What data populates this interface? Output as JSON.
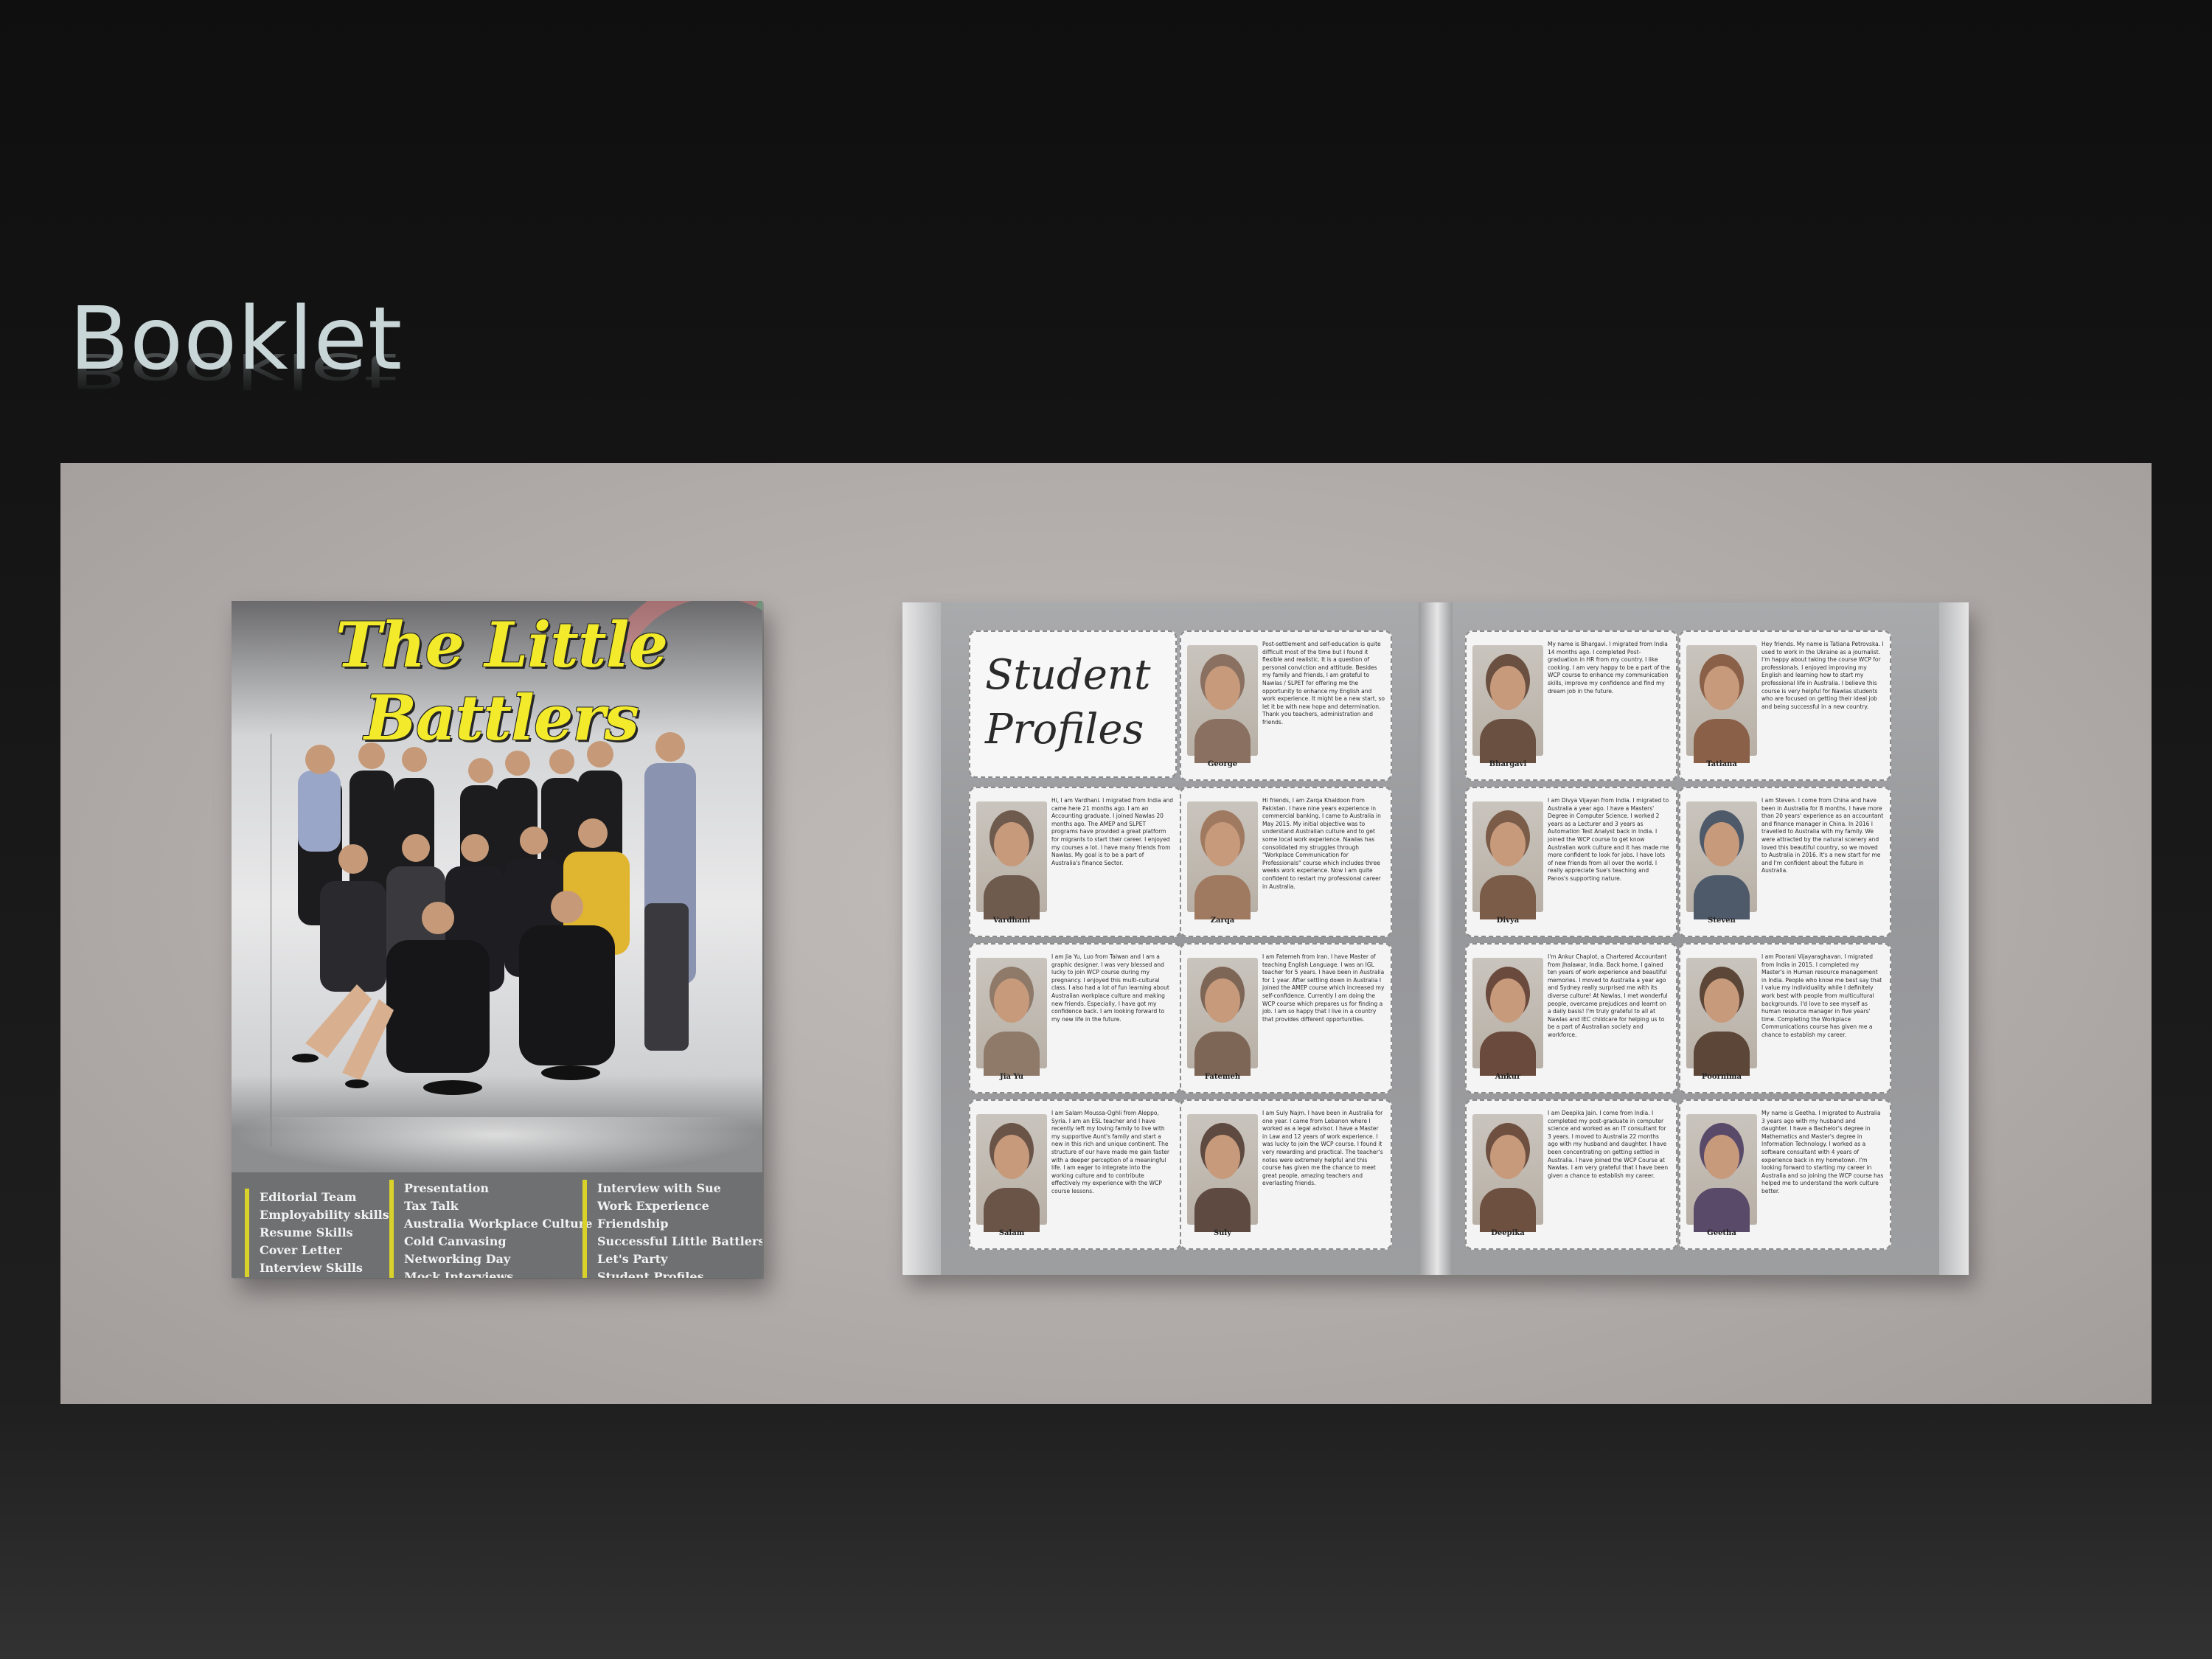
{
  "slide": {
    "title": "Booklet"
  },
  "cover": {
    "title": "The Little Battlers",
    "toc_columns": [
      [
        "Editorial Team",
        "Employability skills",
        "Resume Skills",
        "Cover Letter",
        "Interview Skills"
      ],
      [
        "Presentation",
        "Tax Talk",
        "Australia Workplace Culture",
        "Cold Canvasing",
        "Networking Day",
        "Mock Interviews"
      ],
      [
        "Interview with Sue",
        "Work Experience",
        "Friendship",
        "Successful Little Battlers",
        "Let's Party",
        "Student Profiles"
      ]
    ]
  },
  "spread": {
    "heading": "Student Profiles",
    "left_profiles": [
      {
        "name": "George",
        "text": "Post-settlement and self-education is quite difficult most of the time but I found it flexible and realistic. It is a question of personal conviction and attitude. Besides my family and friends, I am grateful to Nawlas / SLPET for offering me the opportunity to enhance my English and work experience. It might be a new start, so let it be with new hope and determination. Thank you teachers, administration and friends.",
        "photo_color": "#8a7060"
      },
      {
        "name": "Vardhani",
        "text": "Hi, I am Vardhani. I migrated from India and came here 21 months ago. I am an Accounting graduate. I joined Nawlas 20 months ago. The AMEP and SLPET programs have provided a great platform for migrants to start their career. I enjoyed my courses a lot. I have many friends from Nawlas. My goal is to be a part of Australia's finance Sector.",
        "photo_color": "#6f5a4e"
      },
      {
        "name": "Zarqa",
        "text": "Hi friends, I am Zarqa Khaldoon from Pakistan. I have nine years experience in commercial banking. I came to Australia in May 2015. My initial objective was to understand Australian culture and to get some local work experience. Nawlas has consolidated my struggles through \"Workplace Communication for Professionals\" course which includes three weeks work experience. Now I am quite confident to restart my professional career in Australia.",
        "photo_color": "#a07a60"
      },
      {
        "name": "Jia Yu",
        "text": "I am Jia Yu, Luo from Taiwan and I am a graphic designer. I was very blessed and lucky to join WCP course during my pregnancy. I enjoyed this multi-cultural class. I also had a lot of fun learning about Australian workplace culture and making new friends. Especially, I have got my confidence back. I am looking forward to my new life in the future.",
        "photo_color": "#8f7a6a"
      },
      {
        "name": "Fatemeh",
        "text": "I am Fatemeh from Iran. I have Master of teaching English Language. I was an IGL teacher for 5 years. I have been in Australia for 1 year. After settling down in Australia I joined the AMEP course which increased my self-confidence. Currently I am doing the WCP course which prepares us for finding a job. I am so happy that I live in a country that provides different opportunities.",
        "photo_color": "#7e6656"
      },
      {
        "name": "Salam",
        "text": "I am Salam Moussa-Oghli from Aleppo, Syria. I am an ESL teacher and I have recently left my loving family to live with my supportive Aunt's family and start a new in this rich and unique continent. The structure of our have made me gain faster with a deeper perception of a meaningful life. I am eager to integrate into the working culture and to contribute effectively my experience with the WCP course lessons.",
        "photo_color": "#6a5448"
      },
      {
        "name": "Suly",
        "text": "I am Suly Najm. I have been in Australia for one year. I came from Lebanon where I worked as a legal advisor. I have a Master in Law and 12 years of work experience. I was lucky to join the WCP course. I found it very rewarding and practical. The teacher's notes were extremely helpful and this course has given me the chance to meet great people, amazing teachers and everlasting friends.",
        "photo_color": "#5e4a40"
      }
    ],
    "right_profiles": [
      {
        "name": "Bhargavi",
        "text": "My name is Bhargavi. I migrated from India 14 months ago. I completed Post-graduation in HR from my country. I like cooking. I am very happy to be a part of the WCP course to enhance my communication skills, improve my confidence and find my dream job in the future.",
        "photo_color": "#6a5040"
      },
      {
        "name": "Tatiana",
        "text": "Hey friends. My name is Tatiana Petrovska. I used to work in the Ukraine as a journalist. I'm happy about taking the course WCP for professionals. I enjoyed improving my English and learning how to start my professional life in Australia. I believe this course is very helpful for Nawlas students who are focused on getting their ideal job and being successful in a new country.",
        "photo_color": "#8a6048"
      },
      {
        "name": "Divya",
        "text": "I am Divya Vijayan from India. I migrated to Australia a year ago. I have a Masters' Degree in Computer Science. I worked 2 years as a Lecturer and 3 years as Automation Test Analyst back in India. I joined the WCP course to get know Australian work culture and it has made me more confident to look for jobs. I have lots of new friends from all over the world. I really appreciate Sue's teaching and Panos's supporting nature.",
        "photo_color": "#7a5c48"
      },
      {
        "name": "Steven",
        "text": "I am Steven. I come from China and have been in Australia for 8 months. I have more than 20 years' experience as an accountant and finance manager in China. In 2016 I travelled to Australia with my family. We were attracted by the natural scenery and loved this beautiful country, so we moved to Australia in 2016. It's a new start for me and I'm confident about the future in Australia.",
        "photo_color": "#4e5a6a"
      },
      {
        "name": "Ankur",
        "text": "I'm Ankur Chaplot, a Chartered Accountant from Jhalawar, India. Back home, I gained ten years of work experience and beautiful memories. I moved to Australia a year ago and Sydney really surprised me with its diverse culture! At Nawlas, I met wonderful people, overcame prejudices and learnt on a daily basis! I'm truly grateful to all at Nawlas and IEC childcare for helping us to be a part of Australian society and workforce.",
        "photo_color": "#6a4a3c"
      },
      {
        "name": "Poornima",
        "text": "I am Poorani Vijayaraghavan. I migrated from India in 2015. I completed my Master's in Human resource management in India. People who know me best say that I value my individuality while I definitely work best with people from multicultural backgrounds. I'd love to see myself as human resource manager in five years' time. Completing the Workplace Communications course has given me a chance to establish my career.",
        "photo_color": "#5c4638"
      },
      {
        "name": "Deepika",
        "text": "I am Deepika Jain. I come from India. I completed my post-graduate in computer science and worked as an IT consultant for 3 years. I moved to Australia 22 months ago with my husband and daughter. I have been concentrating on getting settled in Australia. I have joined the WCP Course at Nawlas. I am very grateful that I have been given a chance to establish my career.",
        "photo_color": "#6e5040"
      },
      {
        "name": "Geetha",
        "text": "My name is Geetha. I migrated to Australia 3 years ago with my husband and daughter. I have a Bachelor's degree in Mathematics and Master's degree in Information Technology. I worked as a software consultant with 4 years of experience back in my hometown. I'm looking forward to starting my career in Australia and so joining the WCP course has helped me to understand the work culture better.",
        "photo_color": "#5a4a6a"
      }
    ]
  }
}
